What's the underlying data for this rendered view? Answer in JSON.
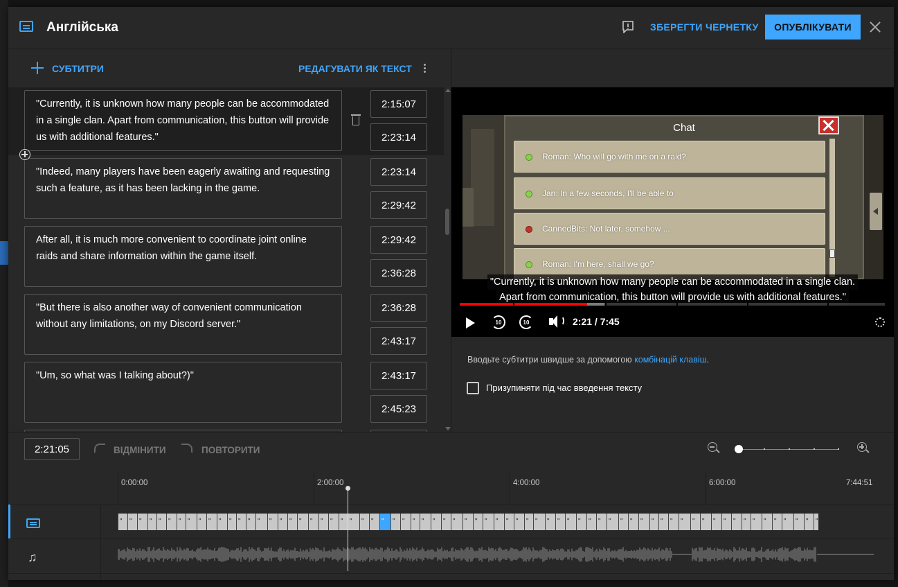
{
  "header": {
    "title": "Англійська",
    "save_draft": "ЗБЕРЕГТИ ЧЕРНЕТКУ",
    "publish": "ОПУБЛІКУВАТИ"
  },
  "toolbar": {
    "add_subtitles": "СУБТИТРИ",
    "edit_as_text": "РЕДАГУВАТИ ЯК ТЕКСТ"
  },
  "subtitles": [
    {
      "text": "\"Currently, it is unknown how many people can be accommodated in a single clan. Apart from communication, this button will provide us with additional features.\"",
      "start": "2:15:07",
      "end": "2:23:14"
    },
    {
      "text": "\"Indeed, many players have been eagerly awaiting and requesting such a feature, as it has been lacking in the game.",
      "start": "2:23:14",
      "end": "2:29:42"
    },
    {
      "text": "After all, it is much more convenient to coordinate joint online raids and share information within the game itself.",
      "start": "2:29:42",
      "end": "2:36:28"
    },
    {
      "text": "\"But there is also another way of convenient communication without any limitations, on my Discord server.\"",
      "start": "2:36:28",
      "end": "2:43:17"
    },
    {
      "text": "\"Um, so what was I talking about?)\"",
      "start": "2:43:17",
      "end": "2:45:23"
    }
  ],
  "video": {
    "chat_title": "Chat",
    "messages": [
      {
        "text": "Roman: Who will go with me on a raid?",
        "status": "green"
      },
      {
        "text": "Jan: In a few seconds, I'll be able to",
        "status": "green"
      },
      {
        "text": "CannedBits: Not later, somehow ...",
        "status": "red"
      },
      {
        "text": "Roman: I'm here, shall we go?",
        "status": "green"
      }
    ],
    "caption_line1": "\"Currently, it is unknown how many people can be accommodated in a single clan.",
    "caption_line2": "Apart from communication, this button will provide us with additional features.\"",
    "time": "2:21 / 7:45",
    "played_fraction": 0.3,
    "buffered_fraction": 0.34,
    "skip_back": "10",
    "skip_forward": "10"
  },
  "hints": {
    "shortcut_prefix": "Вводьте субтитри швидше за допомогою ",
    "shortcut_link": "комбінацій клавіш",
    "shortcut_suffix": ".",
    "pause_label": "Призупиняти під час введення тексту"
  },
  "timeline": {
    "timecode": "2:21:05",
    "undo": "ВІДМІНИТИ",
    "redo": "ПОВТОРИТИ",
    "ruler_labels": [
      "0:00:00",
      "2:00:00",
      "4:00:00",
      "6:00:00",
      "7:44:51"
    ]
  },
  "colors": {
    "accent": "#3ea6ff",
    "progress": "#ff0000"
  }
}
